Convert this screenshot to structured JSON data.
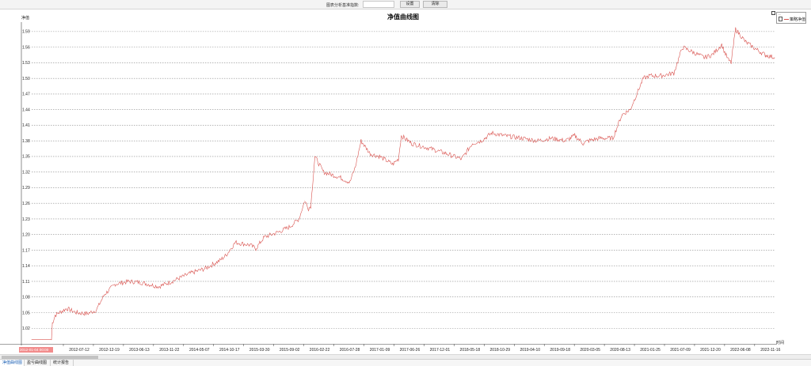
{
  "toolbar": {
    "label": "图表分析基准指数:",
    "input_value": "",
    "set_label": "设置",
    "clear_label": "清除"
  },
  "tabs": [
    {
      "label": "净值曲线图",
      "active": true
    },
    {
      "label": "盈亏曲线图",
      "active": false
    },
    {
      "label": "统计报告",
      "active": false
    }
  ],
  "colors": {
    "series": "#d9534f",
    "grid": "#8c8c8c",
    "highlight": "#f28c8c"
  },
  "chart_data": {
    "type": "line",
    "title": "净值曲线图",
    "ylabel": "净值",
    "xlabel": "时间",
    "ylim": [
      0.99,
      1.605
    ],
    "yticks": [
      1.02,
      1.05,
      1.08,
      1.11,
      1.14,
      1.17,
      1.2,
      1.23,
      1.26,
      1.29,
      1.32,
      1.35,
      1.38,
      1.41,
      1.44,
      1.47,
      1.5,
      1.53,
      1.56,
      1.59
    ],
    "ytick_labels": [
      "1.02",
      "1.05",
      "1.08",
      "1.11",
      "1.14",
      "1.17",
      "1.20",
      "1.23",
      "1.26",
      "1.29",
      "1.32",
      "1.35",
      "1.38",
      "1.41",
      "1.44",
      "1.47",
      "1.50",
      "1.53",
      "1.56",
      "1.59"
    ],
    "x_ticks": [
      "2012-07-12",
      "2012-12-19",
      "2013-06-13",
      "2013-11-22",
      "2014-05-07",
      "2014-10-17",
      "2015-03-30",
      "2015-09-02",
      "2016-02-22",
      "2016-07-28",
      "2017-01-09",
      "2017-06-26",
      "2017-12-01",
      "2018-05-18",
      "2018-10-29",
      "2019-04-10",
      "2019-09-18",
      "2020-03-05",
      "2020-08-13",
      "2021-01-25",
      "2021-07-09",
      "2021-12-20",
      "2022-06-08",
      "2022-11-16"
    ],
    "x_start_label": "2012-01-04 00:00",
    "grid": true,
    "legend_position": "top-right",
    "series": [
      {
        "name": "策略净值",
        "x": [
          "2012-01-04",
          "2012-03-01",
          "2012-04-20",
          "2012-04-25",
          "2012-05-10",
          "2012-06-01",
          "2012-07-12",
          "2012-09-01",
          "2012-11-01",
          "2012-12-19",
          "2013-02-01",
          "2013-04-01",
          "2013-06-13",
          "2013-08-15",
          "2013-11-22",
          "2014-02-01",
          "2014-05-07",
          "2014-08-01",
          "2014-10-17",
          "2014-11-20",
          "2015-01-10",
          "2015-03-30",
          "2015-05-01",
          "2015-06-15",
          "2015-09-02",
          "2015-11-01",
          "2015-12-20",
          "2016-01-20",
          "2016-02-10",
          "2016-02-22",
          "2016-03-15",
          "2016-05-01",
          "2016-07-28",
          "2016-09-20",
          "2016-10-20",
          "2016-11-20",
          "2017-01-09",
          "2017-03-01",
          "2017-05-10",
          "2017-06-10",
          "2017-06-26",
          "2017-08-20",
          "2017-12-01",
          "2018-03-01",
          "2018-05-18",
          "2018-07-15",
          "2018-09-01",
          "2018-10-29",
          "2019-01-01",
          "2019-04-10",
          "2019-07-01",
          "2019-09-18",
          "2019-12-01",
          "2020-01-20",
          "2020-03-05",
          "2020-04-01",
          "2020-06-01",
          "2020-08-13",
          "2020-10-01",
          "2020-11-15",
          "2021-01-25",
          "2021-03-01",
          "2021-05-01",
          "2021-07-09",
          "2021-08-25",
          "2021-12-20",
          "2022-02-01",
          "2022-03-25",
          "2022-04-10",
          "2022-05-01",
          "2022-05-15",
          "2022-06-08",
          "2022-08-01",
          "2022-10-01",
          "2022-11-16",
          "2023-01-05"
        ],
        "y": [
          0.998,
          0.998,
          0.998,
          1.03,
          1.045,
          1.05,
          1.058,
          1.05,
          1.048,
          1.055,
          1.085,
          1.105,
          1.11,
          1.108,
          1.1,
          1.11,
          1.125,
          1.135,
          1.15,
          1.16,
          1.185,
          1.18,
          1.173,
          1.195,
          1.205,
          1.215,
          1.23,
          1.265,
          1.25,
          1.255,
          1.35,
          1.32,
          1.31,
          1.3,
          1.33,
          1.38,
          1.355,
          1.35,
          1.335,
          1.345,
          1.39,
          1.375,
          1.365,
          1.355,
          1.345,
          1.375,
          1.38,
          1.395,
          1.39,
          1.385,
          1.38,
          1.385,
          1.38,
          1.39,
          1.375,
          1.38,
          1.385,
          1.385,
          1.43,
          1.44,
          1.5,
          1.505,
          1.505,
          1.51,
          1.56,
          1.54,
          1.545,
          1.565,
          1.55,
          1.535,
          1.53,
          1.595,
          1.57,
          1.555,
          1.545,
          1.54
        ]
      }
    ]
  }
}
